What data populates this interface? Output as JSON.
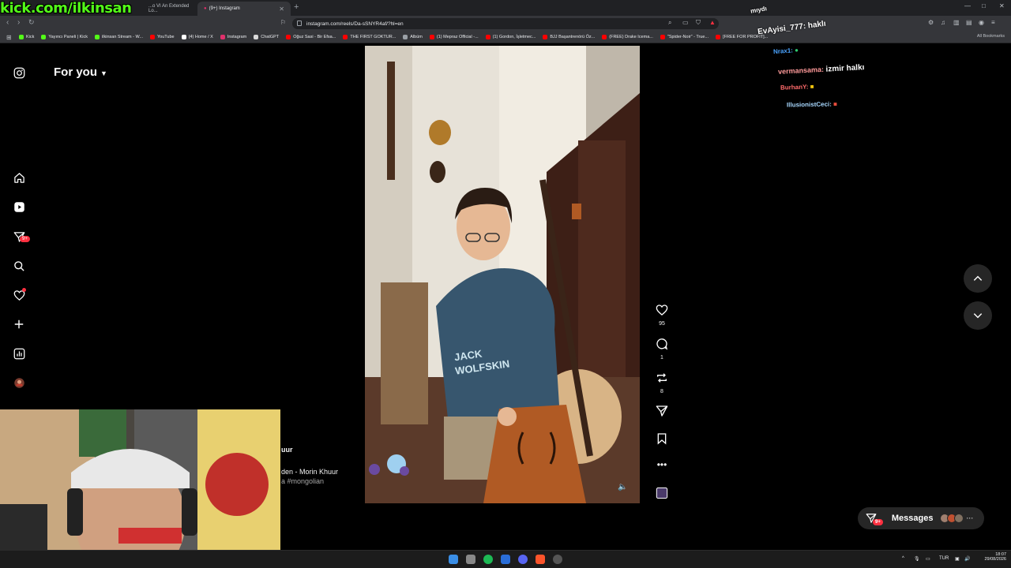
{
  "browser": {
    "tabs": [
      {
        "title": "...o VI An Extended Lo..."
      },
      {
        "title": "(9+) Instagram"
      }
    ],
    "url": "instagram.com/reels/Da-sSNYR4af/?hl=en",
    "bookmarks": [
      {
        "label": "Kick",
        "color": "#53fc18"
      },
      {
        "label": "Yayıncı Paneli | Kick",
        "color": "#53fc18"
      },
      {
        "label": "ilkinsan Stream - W...",
        "color": "#53fc18"
      },
      {
        "label": "YouTube",
        "color": "#ff0000"
      },
      {
        "label": "(4) Home / X",
        "color": "#ffffff"
      },
      {
        "label": "Instagram",
        "color": "#e1306c"
      },
      {
        "label": "ChatGPT",
        "color": "#d9d9d9"
      },
      {
        "label": "Oğuz Sasi - Bir Efsa...",
        "color": "#ff0000"
      },
      {
        "label": "THE FIRST GOKTUR...",
        "color": "#ff0000"
      },
      {
        "label": "Albüm",
        "color": "#9aa0a6"
      },
      {
        "label": "(1) Mepraz Official -...",
        "color": "#ff0000"
      },
      {
        "label": "(1) Gordon, İşletmec...",
        "color": "#ff0000"
      },
      {
        "label": "BJJ Başantrenörü Öz...",
        "color": "#ff0000"
      },
      {
        "label": "(FREE) Drake Icema...",
        "color": "#ff0000"
      },
      {
        "label": "\"Spider-Noir\" - True...",
        "color": "#ff0000"
      },
      {
        "label": "[FREE FOR PROFIT]...",
        "color": "#ff0000"
      }
    ],
    "all_bookmarks": "All Bookmarks"
  },
  "overlay": {
    "kick_url": "kick.com/ilkinsan",
    "chat": [
      {
        "user": "",
        "text": "mıydı",
        "color": "#ffffff"
      },
      {
        "user": "EvAyisi_777:",
        "text": "haklı",
        "color": "#ffffff"
      },
      {
        "user": "Nrax1:",
        "text": "",
        "color": "#4aa3ff"
      },
      {
        "user": "vermansama:",
        "text": "izmir halkı",
        "color": "#ffffff"
      },
      {
        "user": "BurhanY:",
        "text": "",
        "color": "#ff6b6b"
      },
      {
        "user": "IllusionistCeci:",
        "text": "",
        "color": "#a8d8ff"
      }
    ]
  },
  "instagram": {
    "feed_title": "For you",
    "badge_notifications": "9+",
    "video": {
      "shirt_line1": "JACK",
      "shirt_line2": "WOLFSKIN",
      "caption_line1": "uur",
      "caption_line2": "den - Morin Khuur",
      "caption_line3": "a #mongolian"
    },
    "actions": {
      "likes": "95",
      "comments": "1",
      "reposts": "8"
    },
    "messages": {
      "label": "Messages",
      "badge": "9+"
    }
  },
  "taskbar": {
    "lang": "TUR",
    "time": "18:07",
    "date": "29/08/2026"
  }
}
